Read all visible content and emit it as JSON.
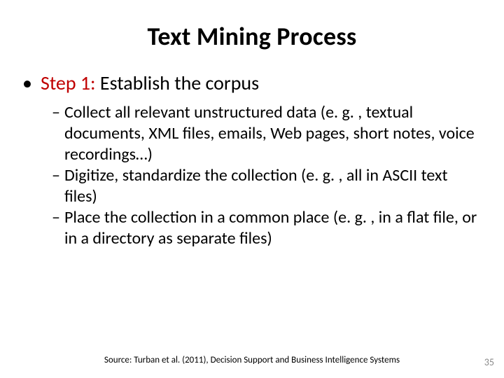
{
  "title": "Text Mining Process",
  "step": {
    "label_prefix": "Step 1: ",
    "label_rest": "Establish the corpus"
  },
  "subs": [
    "Collect all relevant unstructured data \n(e. g. , textual documents, XML files, emails, Web pages, short notes, voice recordings…)",
    "Digitize, standardize the collection \n(e. g. , all in ASCII text files)",
    "Place the collection in a common place \n(e. g. , in a flat file, or in a directory as separate files)"
  ],
  "source": "Source:  Turban et al. (2011), Decision Support and Business Intelligence Systems",
  "page_number": "35"
}
